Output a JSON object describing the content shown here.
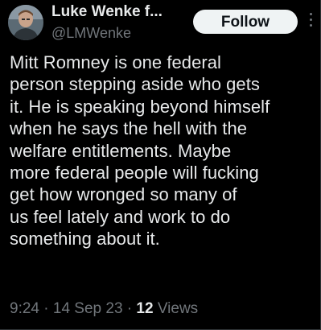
{
  "author": {
    "display_name": "Luke Wenke f...",
    "handle": "@LMWenke",
    "avatar_icon": "user-avatar"
  },
  "actions": {
    "follow_label": "Follow",
    "more_icon": "more-vertical-icon"
  },
  "tweet": {
    "text": "Mitt Romney is one federal\nperson stepping aside who gets\nit.  He is speaking beyond himself\nwhen he says the hell with the\nwelfare entitlements.  Maybe\nmore federal people will fucking\nget how wronged so many of\nus feel lately and work to do\nsomething about it.",
    "time": "9:24",
    "separator": "·",
    "date": "14 Sep 23",
    "views_count": "12",
    "views_label": "Views"
  },
  "colors": {
    "background": "#000000",
    "primary_text": "#e7e9ea",
    "secondary_text": "#71767b",
    "follow_button_bg": "#eff3f4",
    "follow_button_text": "#0f1419"
  }
}
